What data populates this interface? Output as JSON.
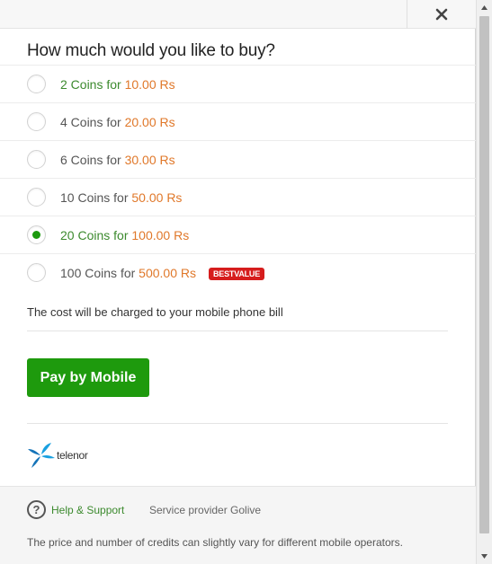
{
  "dialog": {
    "question": "How much would you like to buy?",
    "close_icon": "close-icon"
  },
  "options": [
    {
      "coins": "2 Coins",
      "for": "for",
      "price": "10.00 Rs",
      "selected": false,
      "highlight": true
    },
    {
      "coins": "4 Coins",
      "for": "for",
      "price": "20.00 Rs",
      "selected": false,
      "highlight": false
    },
    {
      "coins": "6 Coins",
      "for": "for",
      "price": "30.00 Rs",
      "selected": false,
      "highlight": false
    },
    {
      "coins": "10 Coins",
      "for": "for",
      "price": "50.00 Rs",
      "selected": false,
      "highlight": false
    },
    {
      "coins": "20 Coins",
      "for": "for",
      "price": "100.00 Rs",
      "selected": true,
      "highlight": true
    },
    {
      "coins": "100 Coins",
      "for": "for",
      "price": "500.00 Rs",
      "selected": false,
      "highlight": false,
      "badge": "BESTVALUE"
    }
  ],
  "cost_note": "The cost will be charged to your mobile phone bill",
  "pay_button": "Pay by Mobile",
  "operator": {
    "name": "telenor",
    "icon": "telenor-logo-icon"
  },
  "footer": {
    "help_icon": "question-circle-icon",
    "help_label": "Help & Support",
    "provider": "Service provider Golive",
    "disclaimer": "The price and number of credits can slightly vary for different mobile operators."
  },
  "colors": {
    "accent_green": "#1e9a0d",
    "price_orange": "#e0782a",
    "badge_red": "#d61d1d"
  }
}
